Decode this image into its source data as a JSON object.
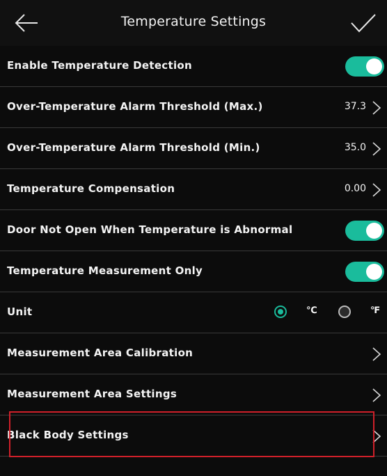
{
  "header": {
    "title": "Temperature Settings",
    "back_icon": "arrow-left-icon",
    "confirm_icon": "checkmark-icon"
  },
  "rows": [
    {
      "label": "Enable Temperature Detection",
      "control": "toggle",
      "on": true
    },
    {
      "label": "Over-Temperature Alarm Threshold (Max.)",
      "control": "value",
      "value": "37.3"
    },
    {
      "label": "Over-Temperature Alarm Threshold (Min.)",
      "control": "value",
      "value": "35.0"
    },
    {
      "label": "Temperature Compensation",
      "control": "value",
      "value": "0.00"
    },
    {
      "label": "Door Not Open When Temperature is Abnormal",
      "control": "toggle",
      "on": true
    },
    {
      "label": "Temperature Measurement Only",
      "control": "toggle",
      "on": true
    },
    {
      "label": "Unit",
      "control": "radio",
      "options": [
        "℃",
        "℉"
      ],
      "selected": "℃"
    },
    {
      "label": "Measurement Area Calibration",
      "control": "chevron"
    },
    {
      "label": "Measurement Area Settings",
      "control": "chevron"
    },
    {
      "label": "Black Body Settings",
      "control": "chevron",
      "highlighted": true
    }
  ],
  "colors": {
    "background": "#0c0c0c",
    "accent": "#1abc9c",
    "highlight": "#d0202a"
  }
}
